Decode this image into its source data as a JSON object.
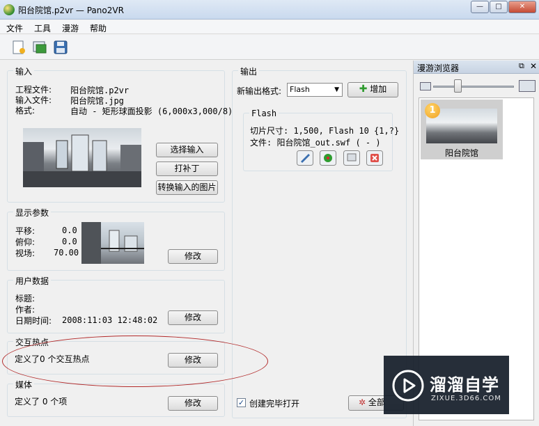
{
  "window": {
    "title": "阳台院馆.p2vr — Pano2VR",
    "controls": {
      "minimize": "—",
      "maximize": "□",
      "close": "✕"
    }
  },
  "menu": {
    "items": [
      "文件",
      "工具",
      "漫游",
      "帮助"
    ]
  },
  "toolbar": {
    "icons": [
      "new-project-icon",
      "open-project-icon",
      "save-icon"
    ]
  },
  "input_group": {
    "title": "输入",
    "rows": [
      {
        "label": "工程文件:",
        "value": "阳台院馆.p2vr"
      },
      {
        "label": "输入文件:",
        "value": "阳台院馆.jpg"
      },
      {
        "label": "格式:",
        "value": "自动 - 矩形球面投影 (6,000x3,000/8)"
      }
    ],
    "buttons": {
      "select_input": "选择输入",
      "patch": "打补丁",
      "convert": "转换输入的图片"
    }
  },
  "display_group": {
    "title": "显示参数",
    "rows": [
      {
        "label": "平移:",
        "value": "0.0"
      },
      {
        "label": "俯仰:",
        "value": "0.0"
      },
      {
        "label": "视场:",
        "value": "70.00"
      }
    ],
    "modify": "修改"
  },
  "user_group": {
    "title": "用户数据",
    "rows": [
      {
        "label": "标题:",
        "value": ""
      },
      {
        "label": "作者:",
        "value": ""
      },
      {
        "label": "日期时间:",
        "value": "2008:11:03 12:48:02"
      }
    ],
    "modify": "修改"
  },
  "hotspot_group": {
    "title": "交互热点",
    "text": "定义了0 个交互热点",
    "modify": "修改"
  },
  "media_group": {
    "title": "媒体",
    "text": "定义了 0 个项",
    "modify": "修改"
  },
  "output_group": {
    "title": "输出",
    "new_format_label": "新输出格式:",
    "format_value": "Flash",
    "add_button": "增加",
    "flash_box": {
      "title": "Flash",
      "tile_size": "切片尺寸: 1,500, Flash 10 {1,?}",
      "file": "文件: 阳台院馆_out.swf ( - )",
      "icons": [
        "settings-wrench-icon",
        "build-gear-icon",
        "preview-icon",
        "delete-icon"
      ]
    },
    "open_after_create": "创建完毕打开",
    "open_after_create_checked": true,
    "build_all": "全部"
  },
  "tour_browser": {
    "title": "漫游浏览器",
    "zoom_level": 0.3,
    "tile": {
      "badge": "1",
      "label": "阳台院馆"
    }
  },
  "watermark": {
    "title": "溜溜自学",
    "url": "ZIXUE.3D66.COM"
  },
  "colors": {
    "accent_ellipse": "#b22a2a",
    "badge": "#f0a020",
    "add_icon": "#2f9b2f"
  }
}
